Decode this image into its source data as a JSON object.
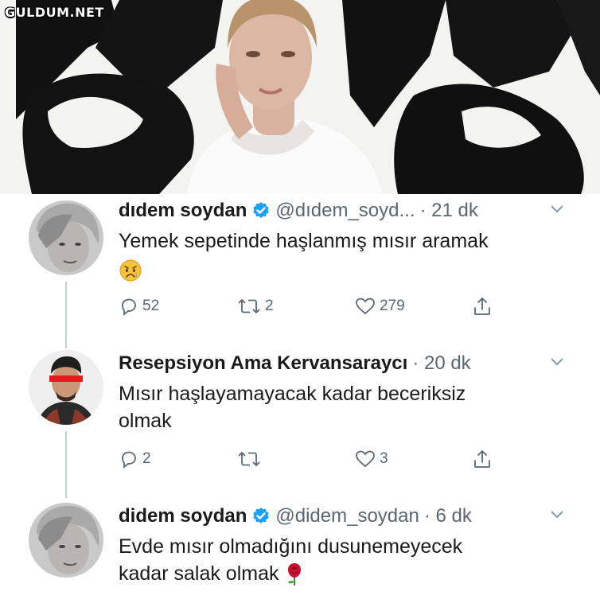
{
  "watermark": "GULDUM.NET",
  "colors": {
    "accent": "#1da1f2",
    "text": "#1a1a1a",
    "muted": "#5b6770",
    "thread_line": "#c4cfd6"
  },
  "tweets": [
    {
      "name": "dıdem soydan",
      "handle": "@dıdem_soyd...",
      "time": "· 21 dk",
      "verified": true,
      "lines": [
        "Yemek sepetinde haşlanmış mısır aramak"
      ],
      "emoji": "disappointed-face-icon",
      "replies": "52",
      "retweets": "2",
      "likes": "279"
    },
    {
      "name": "Resepsiyon Ama Kervansaraycı",
      "handle": "",
      "time": "· 20 dk",
      "verified": false,
      "lines": [
        "Mısır haşlayamayacak kadar beceriksiz",
        "olmak"
      ],
      "replies": "2",
      "retweets": "",
      "likes": "3"
    },
    {
      "name": "didem soydan",
      "handle": "@didem_soydan",
      "time": "· 6 dk",
      "verified": true,
      "lines": [
        "Evde mısır olmadığını dusunemeyecek",
        "kadar salak olmak"
      ],
      "emoji": "rose-icon"
    }
  ]
}
